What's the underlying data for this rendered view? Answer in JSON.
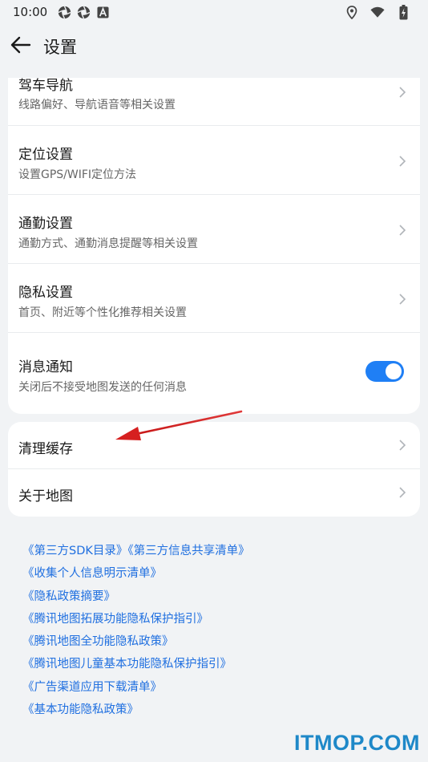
{
  "status_bar": {
    "time": "10:00",
    "left_icons": [
      "aperture-icon",
      "aperture-icon",
      "font-a-icon"
    ],
    "right_icons": [
      "location-pin-icon",
      "wifi-icon",
      "battery-charging-icon"
    ]
  },
  "header": {
    "back_icon": "arrow-left-icon",
    "title": "设置"
  },
  "settings_group_1": [
    {
      "title": "驾车导航",
      "subtitle": "线路偏好、导航语音等相关设置"
    },
    {
      "title": "定位设置",
      "subtitle": "设置GPS/WIFI定位方法"
    },
    {
      "title": "通勤设置",
      "subtitle": "通勤方式、通勤消息提醒等相关设置"
    },
    {
      "title": "隐私设置",
      "subtitle": "首页、附近等个性化推荐相关设置"
    }
  ],
  "notification": {
    "title": "消息通知",
    "subtitle": "关闭后不接受地图发送的任何消息",
    "enabled": true
  },
  "settings_group_2": [
    {
      "title": "清理缓存"
    },
    {
      "title": "关于地图"
    }
  ],
  "links": [
    "《第三方SDK目录》《第三方信息共享清单》",
    "《收集个人信息明示清单》",
    "《隐私政策摘要》",
    "《腾讯地图拓展功能隐私保护指引》",
    "《腾讯地图全功能隐私政策》",
    "《腾讯地图儿童基本功能隐私保护指引》",
    "《广告渠道应用下载清单》",
    "《基本功能隐私政策》"
  ],
  "watermark": "ITMOP.COM",
  "colors": {
    "accent": "#1f7ff5",
    "link": "#1f6fe0",
    "annotation_arrow": "#d62020",
    "watermark": "#1e88c8"
  }
}
